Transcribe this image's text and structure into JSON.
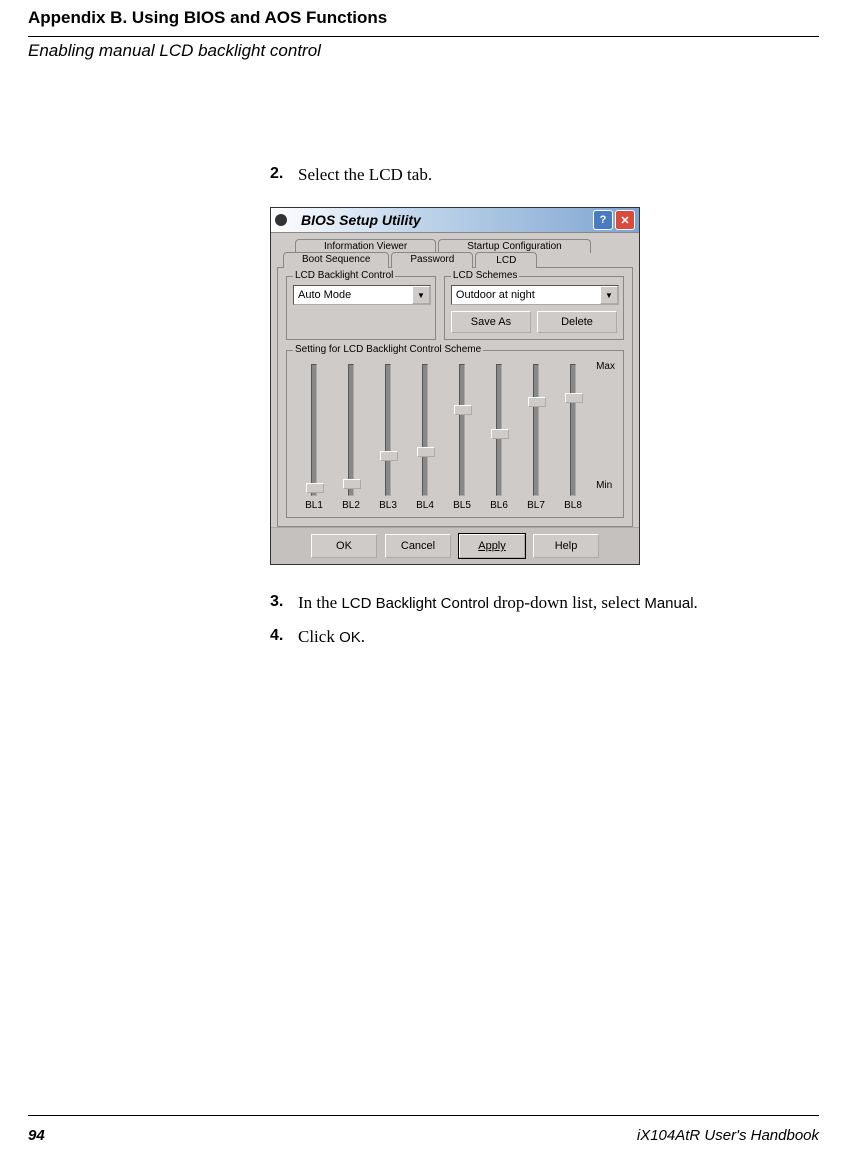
{
  "header": {
    "appendix": "Appendix B. Using BIOS and AOS Functions",
    "subtitle": "Enabling manual LCD backlight control"
  },
  "steps": {
    "s2": {
      "num": "2.",
      "text": "Select the LCD tab."
    },
    "s3": {
      "num": "3.",
      "prefix": "In the ",
      "mid": "LCD Backlight Control",
      "mid2": " drop-down list, select ",
      "end": "Manual",
      "dot": "."
    },
    "s4": {
      "num": "4.",
      "prefix": "Click ",
      "end": "OK",
      "dot": "."
    }
  },
  "bios": {
    "title": "BIOS Setup Utility",
    "help": "?",
    "close": "✕",
    "tabs_row1": {
      "info": "Information Viewer",
      "startup": "Startup Configuration"
    },
    "tabs_row2": {
      "boot": "Boot Sequence",
      "password": "Password",
      "lcd": "LCD"
    },
    "group_backlight": {
      "title": "LCD Backlight Control",
      "value": "Auto Mode"
    },
    "group_schemes": {
      "title": "LCD Schemes",
      "value": "Outdoor at night",
      "save": "Save As",
      "delete": "Delete"
    },
    "sliders_title": "Setting for LCD Backlight Control Scheme",
    "scale_max": "Max",
    "scale_min": "Min",
    "sliders": [
      {
        "label": "BL1",
        "pos": 118
      },
      {
        "label": "BL2",
        "pos": 114
      },
      {
        "label": "BL3",
        "pos": 86
      },
      {
        "label": "BL4",
        "pos": 82
      },
      {
        "label": "BL5",
        "pos": 40
      },
      {
        "label": "BL6",
        "pos": 64
      },
      {
        "label": "BL7",
        "pos": 32
      },
      {
        "label": "BL8",
        "pos": 28
      }
    ],
    "buttons": {
      "ok": "OK",
      "cancel": "Cancel",
      "apply": "Apply",
      "helpb": "Help"
    }
  },
  "footer": {
    "page": "94",
    "book": "iX104AtR User's Handbook"
  }
}
